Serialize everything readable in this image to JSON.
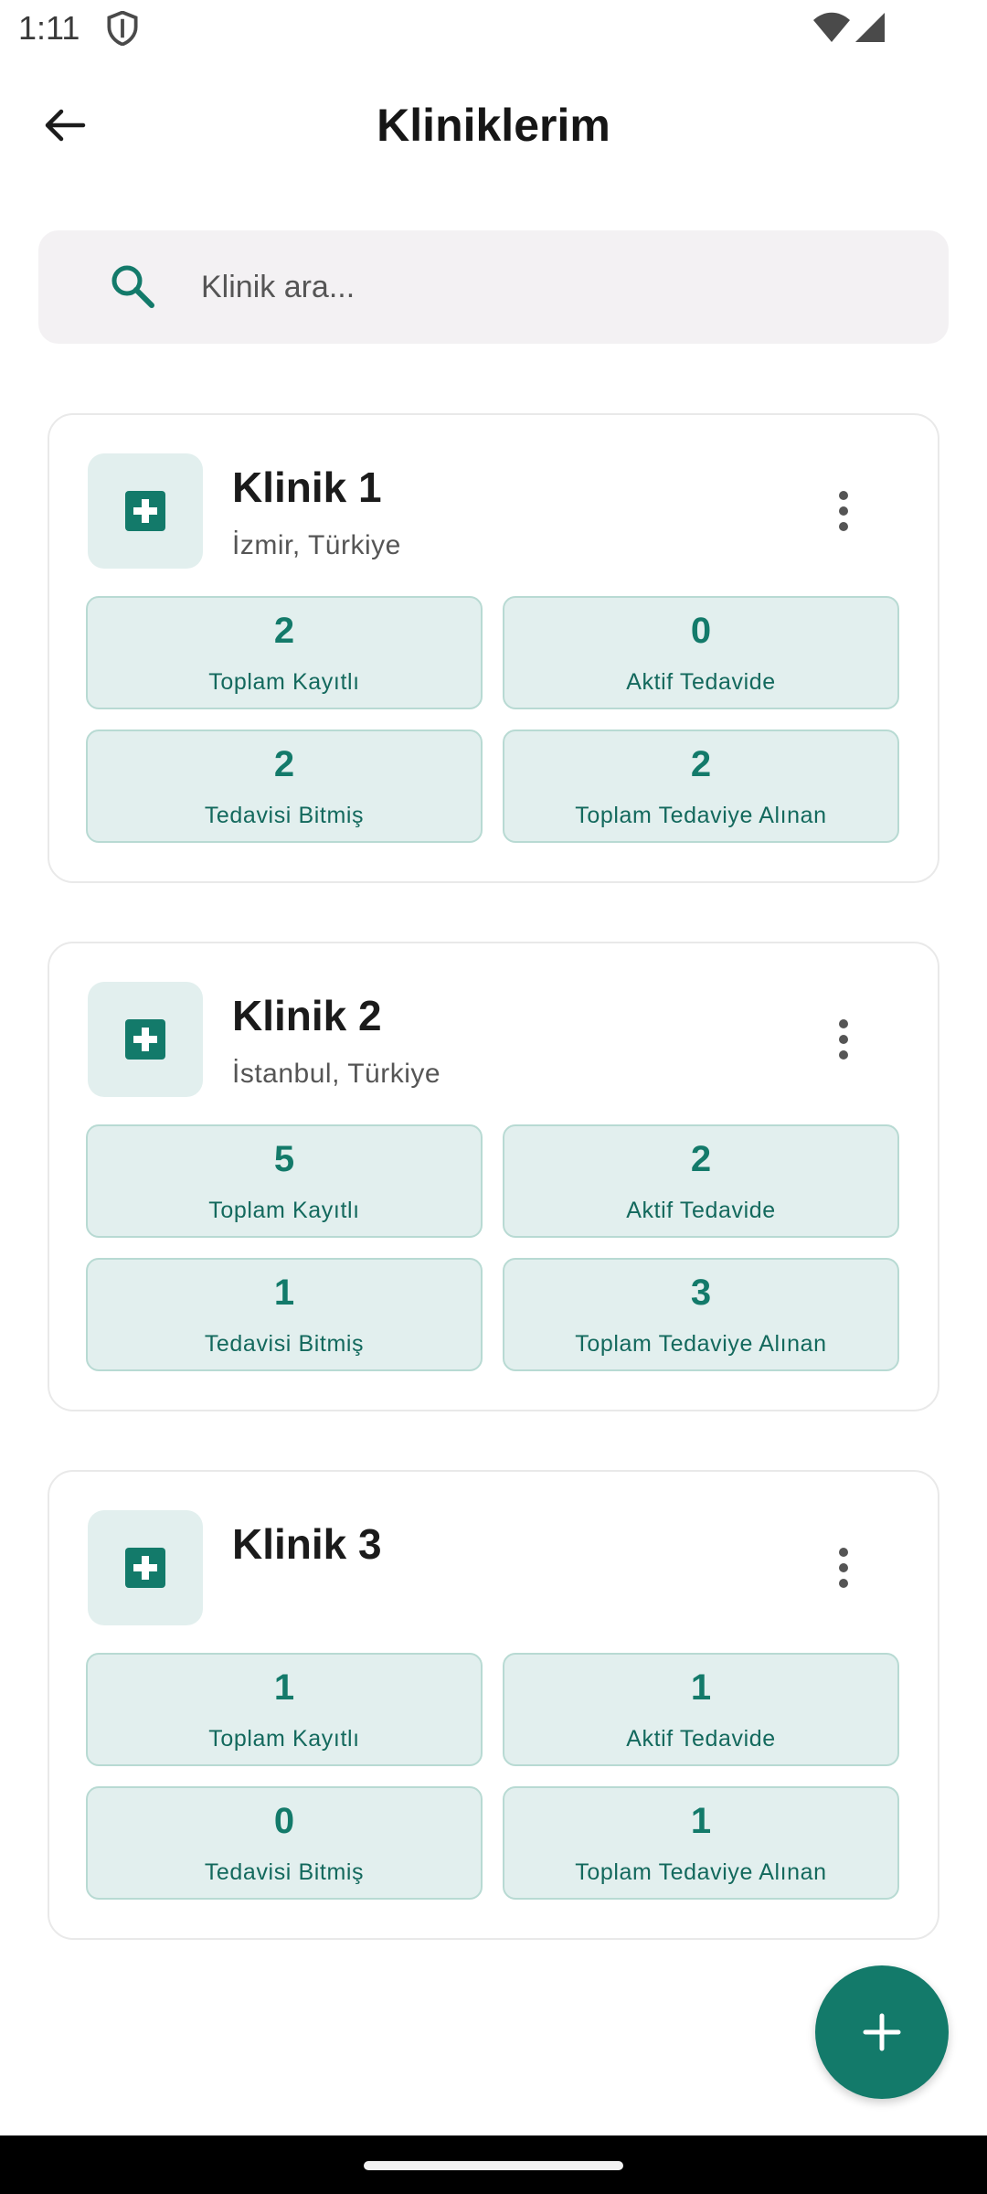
{
  "status_bar": {
    "time": "1:11",
    "icons": [
      "shield-icon",
      "wifi-icon",
      "signal-icon"
    ]
  },
  "app_bar": {
    "title": "Kliniklerim",
    "back_icon": "arrow-left-icon"
  },
  "search": {
    "placeholder": "Klinik ara...",
    "value": "",
    "icon": "search-icon"
  },
  "clinics": [
    {
      "name": "Klinik 1",
      "location": "İzmir, Türkiye",
      "stats": [
        {
          "value": "2",
          "label": "Toplam Kayıtlı"
        },
        {
          "value": "0",
          "label": "Aktif Tedavide"
        },
        {
          "value": "2",
          "label": "Tedavisi Bitmiş"
        },
        {
          "value": "2",
          "label": "Toplam Tedaviye Alınan"
        }
      ]
    },
    {
      "name": "Klinik 2",
      "location": "İstanbul, Türkiye",
      "stats": [
        {
          "value": "5",
          "label": "Toplam Kayıtlı"
        },
        {
          "value": "2",
          "label": "Aktif Tedavide"
        },
        {
          "value": "1",
          "label": "Tedavisi Bitmiş"
        },
        {
          "value": "3",
          "label": "Toplam Tedaviye Alınan"
        }
      ]
    },
    {
      "name": "Klinik 3",
      "location": "",
      "stats": [
        {
          "value": "1",
          "label": "Toplam Kayıtlı"
        },
        {
          "value": "1",
          "label": "Aktif Tedavide"
        },
        {
          "value": "0",
          "label": "Tedavisi Bitmiş"
        },
        {
          "value": "1",
          "label": "Toplam Tedaviye Alınan"
        }
      ]
    }
  ],
  "fab": {
    "icon": "plus-icon"
  },
  "colors": {
    "accent": "#137a6a",
    "tile_bg": "#e2efee",
    "tile_border": "#b8dad3",
    "search_bg": "#f3f1f3"
  }
}
